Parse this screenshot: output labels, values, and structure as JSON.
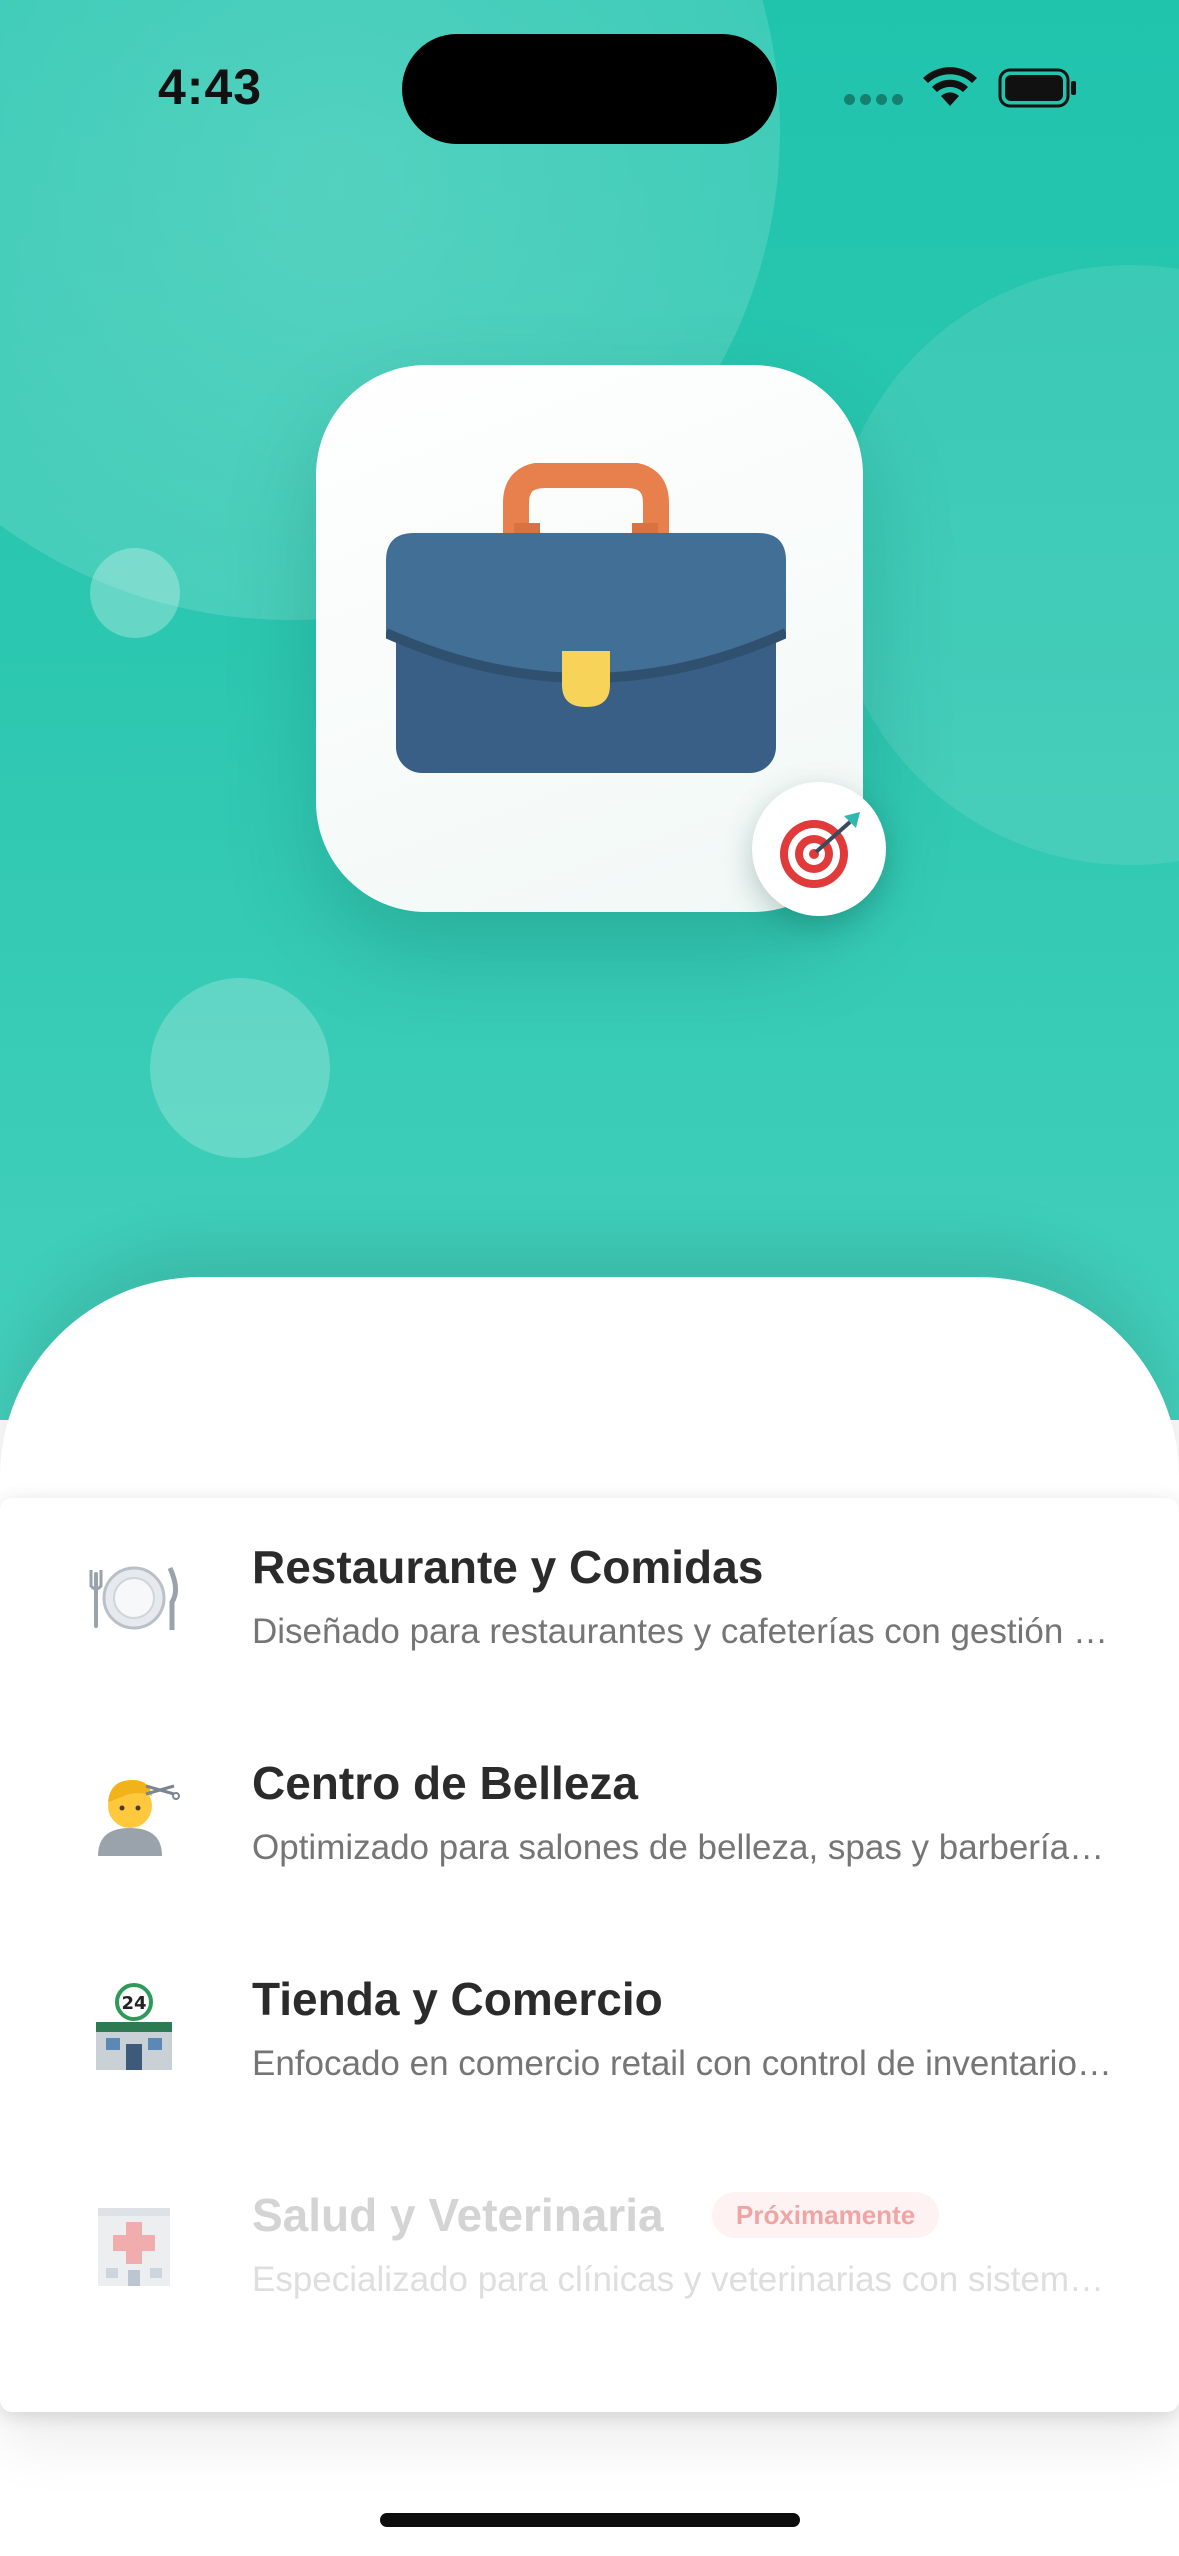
{
  "status_bar": {
    "time": "4:43",
    "icons": [
      "cellular-dots-icon",
      "wifi-icon",
      "battery-icon"
    ]
  },
  "hero": {
    "app_icon": "briefcase-icon",
    "badge_icon": "target-icon",
    "colors": {
      "teal": "#20c4ad",
      "briefcase": "#3d668e",
      "handle": "#e8804d",
      "clasp": "#f7d35a"
    }
  },
  "options": [
    {
      "icon": "plate-cutlery-icon",
      "title": "Restaurante y Comidas",
      "description": "Diseñado para restaurantes y cafeterías con gestión de mesas, comandas y cocina",
      "enabled": true
    },
    {
      "icon": "haircut-icon",
      "title": "Centro de Belleza",
      "description": "Optimizado para salones de belleza, spas y barberías con agenda de citas",
      "enabled": true
    },
    {
      "icon": "convenience-store-icon",
      "title": "Tienda y Comercio",
      "description": "Enfocado en comercio retail con control de inventario y ventas",
      "enabled": true
    },
    {
      "icon": "hospital-icon",
      "title": "Salud y Veterinaria",
      "description": "Especializado para clínicas y veterinarias con sistema de historias clínicas",
      "enabled": false,
      "badge": "Próximamente"
    }
  ]
}
